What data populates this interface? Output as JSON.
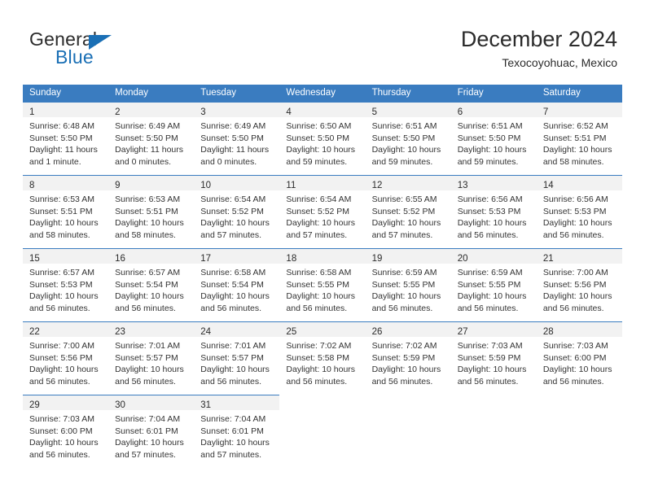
{
  "brand": {
    "name_part1": "General",
    "name_part2": "Blue",
    "triangle_color": "#1a6fb5"
  },
  "header": {
    "title": "December 2024",
    "subtitle": "Texocoyohuac, Mexico"
  },
  "theme": {
    "header_row_bg": "#3a7cc0",
    "daynum_bg": "#f2f2f2",
    "grid_line": "#3a7cc0",
    "text": "#2b2b2b"
  },
  "weekdays": [
    "Sunday",
    "Monday",
    "Tuesday",
    "Wednesday",
    "Thursday",
    "Friday",
    "Saturday"
  ],
  "weeks": [
    [
      {
        "day": "1",
        "sunrise": "Sunrise: 6:48 AM",
        "sunset": "Sunset: 5:50 PM",
        "daylight_line1": "Daylight: 11 hours",
        "daylight_line2": "and 1 minute."
      },
      {
        "day": "2",
        "sunrise": "Sunrise: 6:49 AM",
        "sunset": "Sunset: 5:50 PM",
        "daylight_line1": "Daylight: 11 hours",
        "daylight_line2": "and 0 minutes."
      },
      {
        "day": "3",
        "sunrise": "Sunrise: 6:49 AM",
        "sunset": "Sunset: 5:50 PM",
        "daylight_line1": "Daylight: 11 hours",
        "daylight_line2": "and 0 minutes."
      },
      {
        "day": "4",
        "sunrise": "Sunrise: 6:50 AM",
        "sunset": "Sunset: 5:50 PM",
        "daylight_line1": "Daylight: 10 hours",
        "daylight_line2": "and 59 minutes."
      },
      {
        "day": "5",
        "sunrise": "Sunrise: 6:51 AM",
        "sunset": "Sunset: 5:50 PM",
        "daylight_line1": "Daylight: 10 hours",
        "daylight_line2": "and 59 minutes."
      },
      {
        "day": "6",
        "sunrise": "Sunrise: 6:51 AM",
        "sunset": "Sunset: 5:50 PM",
        "daylight_line1": "Daylight: 10 hours",
        "daylight_line2": "and 59 minutes."
      },
      {
        "day": "7",
        "sunrise": "Sunrise: 6:52 AM",
        "sunset": "Sunset: 5:51 PM",
        "daylight_line1": "Daylight: 10 hours",
        "daylight_line2": "and 58 minutes."
      }
    ],
    [
      {
        "day": "8",
        "sunrise": "Sunrise: 6:53 AM",
        "sunset": "Sunset: 5:51 PM",
        "daylight_line1": "Daylight: 10 hours",
        "daylight_line2": "and 58 minutes."
      },
      {
        "day": "9",
        "sunrise": "Sunrise: 6:53 AM",
        "sunset": "Sunset: 5:51 PM",
        "daylight_line1": "Daylight: 10 hours",
        "daylight_line2": "and 58 minutes."
      },
      {
        "day": "10",
        "sunrise": "Sunrise: 6:54 AM",
        "sunset": "Sunset: 5:52 PM",
        "daylight_line1": "Daylight: 10 hours",
        "daylight_line2": "and 57 minutes."
      },
      {
        "day": "11",
        "sunrise": "Sunrise: 6:54 AM",
        "sunset": "Sunset: 5:52 PM",
        "daylight_line1": "Daylight: 10 hours",
        "daylight_line2": "and 57 minutes."
      },
      {
        "day": "12",
        "sunrise": "Sunrise: 6:55 AM",
        "sunset": "Sunset: 5:52 PM",
        "daylight_line1": "Daylight: 10 hours",
        "daylight_line2": "and 57 minutes."
      },
      {
        "day": "13",
        "sunrise": "Sunrise: 6:56 AM",
        "sunset": "Sunset: 5:53 PM",
        "daylight_line1": "Daylight: 10 hours",
        "daylight_line2": "and 56 minutes."
      },
      {
        "day": "14",
        "sunrise": "Sunrise: 6:56 AM",
        "sunset": "Sunset: 5:53 PM",
        "daylight_line1": "Daylight: 10 hours",
        "daylight_line2": "and 56 minutes."
      }
    ],
    [
      {
        "day": "15",
        "sunrise": "Sunrise: 6:57 AM",
        "sunset": "Sunset: 5:53 PM",
        "daylight_line1": "Daylight: 10 hours",
        "daylight_line2": "and 56 minutes."
      },
      {
        "day": "16",
        "sunrise": "Sunrise: 6:57 AM",
        "sunset": "Sunset: 5:54 PM",
        "daylight_line1": "Daylight: 10 hours",
        "daylight_line2": "and 56 minutes."
      },
      {
        "day": "17",
        "sunrise": "Sunrise: 6:58 AM",
        "sunset": "Sunset: 5:54 PM",
        "daylight_line1": "Daylight: 10 hours",
        "daylight_line2": "and 56 minutes."
      },
      {
        "day": "18",
        "sunrise": "Sunrise: 6:58 AM",
        "sunset": "Sunset: 5:55 PM",
        "daylight_line1": "Daylight: 10 hours",
        "daylight_line2": "and 56 minutes."
      },
      {
        "day": "19",
        "sunrise": "Sunrise: 6:59 AM",
        "sunset": "Sunset: 5:55 PM",
        "daylight_line1": "Daylight: 10 hours",
        "daylight_line2": "and 56 minutes."
      },
      {
        "day": "20",
        "sunrise": "Sunrise: 6:59 AM",
        "sunset": "Sunset: 5:55 PM",
        "daylight_line1": "Daylight: 10 hours",
        "daylight_line2": "and 56 minutes."
      },
      {
        "day": "21",
        "sunrise": "Sunrise: 7:00 AM",
        "sunset": "Sunset: 5:56 PM",
        "daylight_line1": "Daylight: 10 hours",
        "daylight_line2": "and 56 minutes."
      }
    ],
    [
      {
        "day": "22",
        "sunrise": "Sunrise: 7:00 AM",
        "sunset": "Sunset: 5:56 PM",
        "daylight_line1": "Daylight: 10 hours",
        "daylight_line2": "and 56 minutes."
      },
      {
        "day": "23",
        "sunrise": "Sunrise: 7:01 AM",
        "sunset": "Sunset: 5:57 PM",
        "daylight_line1": "Daylight: 10 hours",
        "daylight_line2": "and 56 minutes."
      },
      {
        "day": "24",
        "sunrise": "Sunrise: 7:01 AM",
        "sunset": "Sunset: 5:57 PM",
        "daylight_line1": "Daylight: 10 hours",
        "daylight_line2": "and 56 minutes."
      },
      {
        "day": "25",
        "sunrise": "Sunrise: 7:02 AM",
        "sunset": "Sunset: 5:58 PM",
        "daylight_line1": "Daylight: 10 hours",
        "daylight_line2": "and 56 minutes."
      },
      {
        "day": "26",
        "sunrise": "Sunrise: 7:02 AM",
        "sunset": "Sunset: 5:59 PM",
        "daylight_line1": "Daylight: 10 hours",
        "daylight_line2": "and 56 minutes."
      },
      {
        "day": "27",
        "sunrise": "Sunrise: 7:03 AM",
        "sunset": "Sunset: 5:59 PM",
        "daylight_line1": "Daylight: 10 hours",
        "daylight_line2": "and 56 minutes."
      },
      {
        "day": "28",
        "sunrise": "Sunrise: 7:03 AM",
        "sunset": "Sunset: 6:00 PM",
        "daylight_line1": "Daylight: 10 hours",
        "daylight_line2": "and 56 minutes."
      }
    ],
    [
      {
        "day": "29",
        "sunrise": "Sunrise: 7:03 AM",
        "sunset": "Sunset: 6:00 PM",
        "daylight_line1": "Daylight: 10 hours",
        "daylight_line2": "and 56 minutes."
      },
      {
        "day": "30",
        "sunrise": "Sunrise: 7:04 AM",
        "sunset": "Sunset: 6:01 PM",
        "daylight_line1": "Daylight: 10 hours",
        "daylight_line2": "and 57 minutes."
      },
      {
        "day": "31",
        "sunrise": "Sunrise: 7:04 AM",
        "sunset": "Sunset: 6:01 PM",
        "daylight_line1": "Daylight: 10 hours",
        "daylight_line2": "and 57 minutes."
      },
      {
        "day": "",
        "sunrise": "",
        "sunset": "",
        "daylight_line1": "",
        "daylight_line2": ""
      },
      {
        "day": "",
        "sunrise": "",
        "sunset": "",
        "daylight_line1": "",
        "daylight_line2": ""
      },
      {
        "day": "",
        "sunrise": "",
        "sunset": "",
        "daylight_line1": "",
        "daylight_line2": ""
      },
      {
        "day": "",
        "sunrise": "",
        "sunset": "",
        "daylight_line1": "",
        "daylight_line2": ""
      }
    ]
  ]
}
